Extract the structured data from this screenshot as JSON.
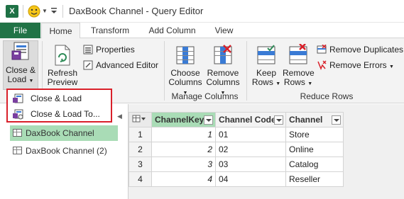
{
  "window": {
    "title": "DaxBook Channel - Query Editor",
    "excel_icon_letter": "X"
  },
  "tabs": [
    "File",
    "Home",
    "Transform",
    "Add Column",
    "View"
  ],
  "ribbon": {
    "close_load": {
      "line1": "Close &",
      "line2": "Load"
    },
    "refresh": {
      "line1": "Refresh",
      "line2": "Preview"
    },
    "properties": "Properties",
    "advanced_editor": "Advanced Editor",
    "choose_columns": {
      "line1": "Choose",
      "line2": "Columns"
    },
    "remove_columns": {
      "line1": "Remove",
      "line2": "Columns"
    },
    "keep_rows": {
      "line1": "Keep",
      "line2": "Rows"
    },
    "remove_rows": {
      "line1": "Remove",
      "line2": "Rows"
    },
    "remove_duplicates": "Remove Duplicates",
    "remove_errors": "Remove Errors",
    "group_manage_columns": "Manage Columns",
    "group_reduce_rows": "Reduce Rows"
  },
  "dropdown": {
    "items": [
      "Close & Load",
      "Close & Load To..."
    ]
  },
  "queries": [
    "DaxBook Channel",
    "DaxBook Channel (2)"
  ],
  "grid": {
    "headers": [
      "ChannelKey",
      "Channel Code",
      "Channel"
    ],
    "rows": [
      {
        "num": "1",
        "key": "1",
        "code": "01",
        "channel": "Store"
      },
      {
        "num": "2",
        "key": "2",
        "code": "02",
        "channel": "Online"
      },
      {
        "num": "3",
        "key": "3",
        "code": "03",
        "channel": "Catalog"
      },
      {
        "num": "4",
        "key": "4",
        "code": "04",
        "channel": "Reseller"
      }
    ]
  },
  "colors": {
    "file_tab": "#217346",
    "selection_green": "#a9dcb6",
    "highlight_red": "#d9202a"
  }
}
